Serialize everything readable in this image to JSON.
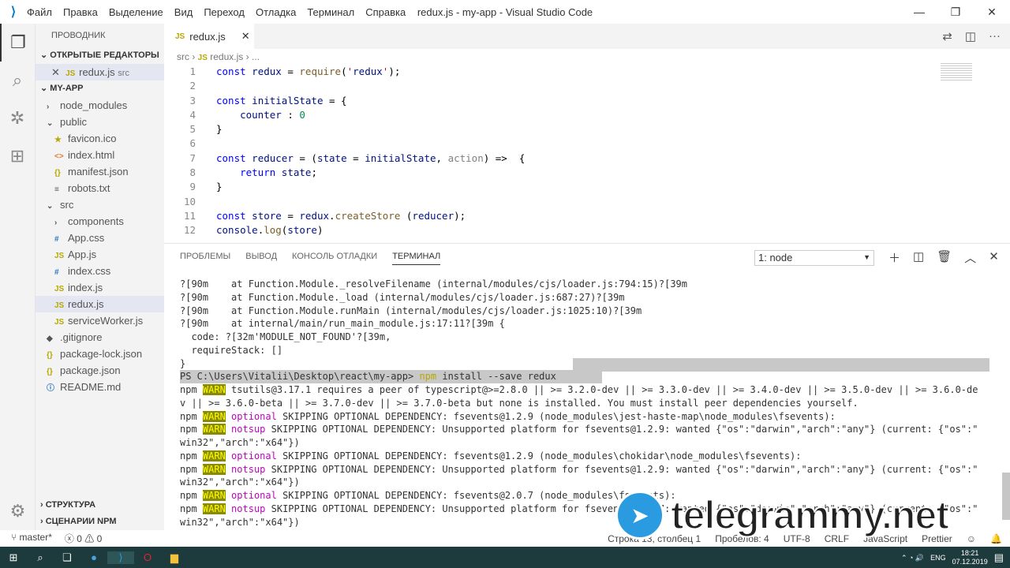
{
  "titlebar": {
    "menu": [
      "Файл",
      "Правка",
      "Выделение",
      "Вид",
      "Переход",
      "Отладка",
      "Терминал",
      "Справка"
    ],
    "title": "redux.js - my-app - Visual Studio Code"
  },
  "sidebar": {
    "title": "ПРОВОДНИК",
    "open_editors": "ОТКРЫТЫЕ РЕДАКТОРЫ",
    "open_file": "redux.js",
    "open_file_dir": "src",
    "project": "MY-APP",
    "tree": [
      {
        "label": "node_modules",
        "type": "folder",
        "depth": 0,
        "open": false
      },
      {
        "label": "public",
        "type": "folder",
        "depth": 0,
        "open": true
      },
      {
        "label": "favicon.ico",
        "type": "star",
        "depth": 1
      },
      {
        "label": "index.html",
        "type": "html",
        "depth": 1
      },
      {
        "label": "manifest.json",
        "type": "json",
        "depth": 1
      },
      {
        "label": "robots.txt",
        "type": "txt",
        "depth": 1
      },
      {
        "label": "src",
        "type": "folder",
        "depth": 0,
        "open": true
      },
      {
        "label": "components",
        "type": "folder",
        "depth": 1,
        "open": false
      },
      {
        "label": "App.css",
        "type": "css",
        "depth": 1
      },
      {
        "label": "App.js",
        "type": "js",
        "depth": 1
      },
      {
        "label": "index.css",
        "type": "css",
        "depth": 1
      },
      {
        "label": "index.js",
        "type": "js",
        "depth": 1
      },
      {
        "label": "redux.js",
        "type": "js",
        "depth": 1,
        "selected": true
      },
      {
        "label": "serviceWorker.js",
        "type": "js",
        "depth": 1
      },
      {
        "label": ".gitignore",
        "type": "git",
        "depth": 0
      },
      {
        "label": "package-lock.json",
        "type": "json",
        "depth": 0
      },
      {
        "label": "package.json",
        "type": "json",
        "depth": 0
      },
      {
        "label": "README.md",
        "type": "md",
        "depth": 0
      }
    ],
    "outline": "СТРУКТУРА",
    "npm": "СЦЕНАРИИ NPM"
  },
  "tab": {
    "label": "redux.js"
  },
  "breadcrumb": [
    "src",
    "redux.js",
    "..."
  ],
  "code": [
    "const redux = require('redux');",
    "",
    "const initialState = {",
    "    counter : 0",
    "}",
    "",
    "const reducer = (state = initialState, action) =>  {",
    "    return state;",
    "}",
    "",
    "const store = redux.createStore (reducer);",
    "console.log(store)"
  ],
  "panel": {
    "tabs": [
      "ПРОБЛЕМЫ",
      "ВЫВОД",
      "КОНСОЛЬ ОТЛАДКИ",
      "ТЕРМИНАЛ"
    ],
    "active": "ТЕРМИНАЛ",
    "terminal_select": "1: node"
  },
  "terminal": [
    "?[90m    at Function.Module._resolveFilename (internal/modules/cjs/loader.js:794:15)?[39m",
    "?[90m    at Function.Module._load (internal/modules/cjs/loader.js:687:27)?[39m",
    "?[90m    at Function.Module.runMain (internal/modules/cjs/loader.js:1025:10)?[39m",
    "?[90m    at internal/main/run_main_module.js:17:11?[39m {",
    "  code: ?[32m'MODULE_NOT_FOUND'?[39m,",
    "  requireStack: []",
    "}",
    "PS C:\\Users\\Vitalii\\Desktop\\react\\my-app> npm install --save redux",
    "npm WARN tsutils@3.17.1 requires a peer of typescript@>=2.8.0 || >= 3.2.0-dev || >= 3.3.0-dev || >= 3.4.0-dev || >= 3.5.0-dev || >= 3.6.0-de",
    "v || >= 3.6.0-beta || >= 3.7.0-dev || >= 3.7.0-beta but none is installed. You must install peer dependencies yourself.",
    "npm WARN optional SKIPPING OPTIONAL DEPENDENCY: fsevents@1.2.9 (node_modules\\jest-haste-map\\node_modules\\fsevents):",
    "npm WARN notsup SKIPPING OPTIONAL DEPENDENCY: Unsupported platform for fsevents@1.2.9: wanted {\"os\":\"darwin\",\"arch\":\"any\"} (current: {\"os\":\"",
    "win32\",\"arch\":\"x64\"})",
    "npm WARN optional SKIPPING OPTIONAL DEPENDENCY: fsevents@1.2.9 (node_modules\\chokidar\\node_modules\\fsevents):",
    "npm WARN notsup SKIPPING OPTIONAL DEPENDENCY: Unsupported platform for fsevents@1.2.9: wanted {\"os\":\"darwin\",\"arch\":\"any\"} (current: {\"os\":\"",
    "win32\",\"arch\":\"x64\"})",
    "npm WARN optional SKIPPING OPTIONAL DEPENDENCY: fsevents@2.0.7 (node_modules\\fsevents):",
    "npm WARN notsup SKIPPING OPTIONAL DEPENDENCY: Unsupported platform for fsevents@2.0.7: wanted {\"os\":\"darwin\",\"arch\":\"any\"} (current: {\"os\":\"",
    "win32\",\"arch\":\"x64\"})"
  ],
  "status": {
    "branch": "master*",
    "errors": "0",
    "warnings": "0",
    "position": "Строка 13, столбец 1",
    "spaces": "Пробелов: 4",
    "encoding": "UTF-8",
    "eol": "CRLF",
    "language": "JavaScript",
    "formatter": "Prettier"
  },
  "taskbar": {
    "lang": "ENG",
    "time": "18:21",
    "date": "07.12.2019"
  },
  "watermark": "telegrammy.net",
  "colors": {
    "accent": "#007acc",
    "warn_bg": "#8a8a00",
    "taskbar": "#1d3a3c"
  }
}
